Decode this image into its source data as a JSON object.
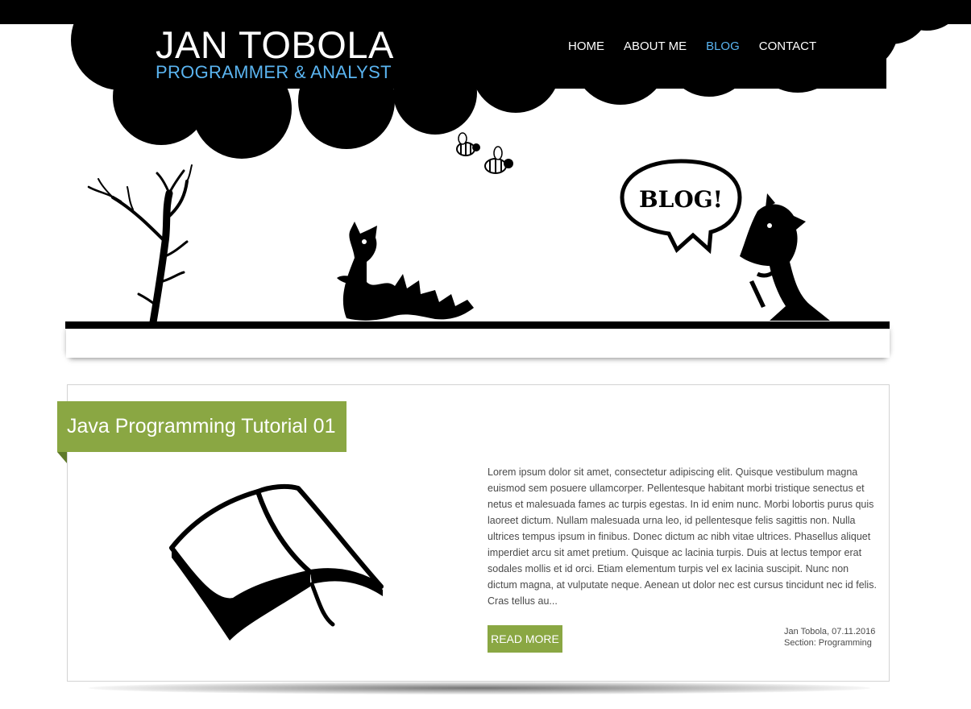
{
  "header": {
    "name": "JAN TOBOLA",
    "subtitle": "PROGRAMMER & ANALYST",
    "nav": [
      {
        "label": "HOME",
        "active": false
      },
      {
        "label": "ABOUT ME",
        "active": false
      },
      {
        "label": "BLOG",
        "active": true
      },
      {
        "label": "CONTACT",
        "active": false
      }
    ]
  },
  "hero": {
    "speech_bubble_text": "BLOG!"
  },
  "post": {
    "title": "Java Programming Tutorial 01",
    "excerpt": "Lorem ipsum dolor sit amet, consectetur adipiscing elit. Quisque vestibulum magna euismod sem posuere ullamcorper. Pellentesque habitant morbi tristique senectus et netus et malesuada fames ac turpis egestas. In id enim nunc. Morbi lobortis purus quis laoreet dictum. Nullam malesuada urna leo, id pellentesque felis sagittis non. Nulla ultrices tempus ipsum in finibus. Donec dictum ac nibh vitae ultrices. Phasellus aliquet imperdiet arcu sit amet pretium. Quisque ac lacinia turpis. Duis at lectus tempor erat sodales mollis et id orci. Etiam elementum turpis vel ex lacinia suscipit. Nunc non dictum magna, at vulputate neque. Aenean ut dolor nec est cursus tincidunt nec id felis. Cras tellus au...",
    "read_more_label": "READ MORE",
    "meta_author_date": "Jan Tobola, 07.11.2016",
    "meta_section": "Section: Programming",
    "image_icon": "open-book-icon"
  },
  "colors": {
    "accent_green": "#8aa743",
    "accent_blue": "#5ab4f0",
    "header_black": "#000000"
  }
}
